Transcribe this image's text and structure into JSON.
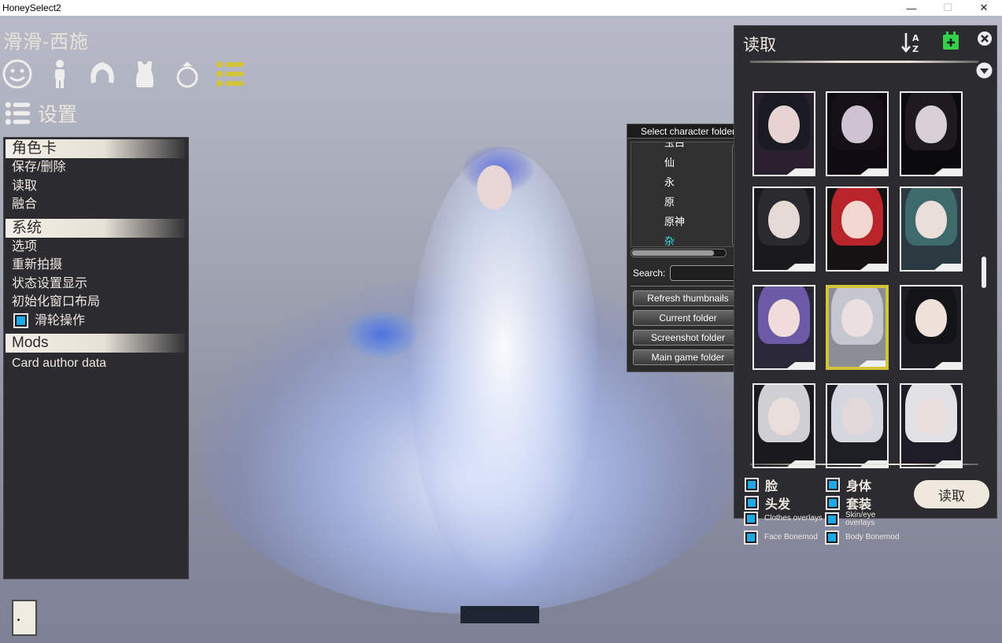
{
  "window": {
    "title": "HoneySelect2"
  },
  "header": {
    "character_name": "滑滑-西施",
    "settings_label": "设置"
  },
  "category_icons": [
    "face-icon",
    "body-icon",
    "hair-icon",
    "clothes-icon",
    "accessory-icon",
    "settings-list-icon"
  ],
  "left_menu": {
    "sections": [
      {
        "title": "角色卡",
        "items": [
          "保存/删除",
          "读取",
          "融合"
        ]
      },
      {
        "title": "系统",
        "items": [
          "选项",
          "重新拍摄",
          "状态设置显示",
          "初始化窗口布局"
        ],
        "toggle": {
          "label": "滑轮操作",
          "checked": true
        }
      },
      {
        "title": "Mods",
        "items": [
          "Card author data"
        ]
      }
    ]
  },
  "folder_popup": {
    "title": "Select character folder",
    "nodes": [
      {
        "label": "玉白",
        "selected": false
      },
      {
        "label": "仙",
        "selected": false
      },
      {
        "label": "永",
        "selected": false
      },
      {
        "label": "原",
        "selected": false
      },
      {
        "label": "原神",
        "selected": false
      },
      {
        "label": "杂",
        "selected": true
      }
    ],
    "search_label": "Search:",
    "search_value": "",
    "buttons": [
      "Refresh thumbnails",
      "Current folder",
      "Screenshot folder",
      "Main game folder"
    ]
  },
  "load_panel": {
    "title": "读取",
    "load_button": "读取",
    "options": [
      {
        "label": "脸",
        "checked": true,
        "small": false
      },
      {
        "label": "身体",
        "checked": true,
        "small": false
      },
      {
        "label": "头发",
        "checked": true,
        "small": false
      },
      {
        "label": "套装",
        "checked": true,
        "small": false
      },
      {
        "label": "Clothes overlays",
        "checked": true,
        "small": true
      },
      {
        "label": "Skin/eye overlays",
        "checked": true,
        "small": true
      },
      {
        "label": "Face Bonemod",
        "checked": true,
        "small": true
      },
      {
        "label": "Body Bonemod",
        "checked": true,
        "small": true
      }
    ],
    "thumbnails": [
      {
        "hair": "#1a1a22",
        "skin": "#e7d4d2",
        "bg": "#2a2030",
        "selected": false
      },
      {
        "hair": "#151018",
        "skin": "#cfc2d2",
        "bg": "#0e0c12",
        "selected": false
      },
      {
        "hair": "#1d1b1f",
        "skin": "#d8d0d4",
        "bg": "#0b0b0d",
        "selected": false
      },
      {
        "hair": "#2a2a2e",
        "skin": "#e6dad6",
        "bg": "#1a1a1c",
        "selected": false
      },
      {
        "hair": "#b8242a",
        "skin": "#f0d8d0",
        "bg": "#141212",
        "selected": false
      },
      {
        "hair": "#3e6a6c",
        "skin": "#eadfd8",
        "bg": "#2a3a40",
        "selected": false
      },
      {
        "hair": "#6c5aa6",
        "skin": "#f0dcd8",
        "bg": "#2a2838",
        "selected": false
      },
      {
        "hair": "#c4c6d0",
        "skin": "#ecdfe0",
        "bg": "#8a8c96",
        "selected": true
      },
      {
        "hair": "#121418",
        "skin": "#efe0da",
        "bg": "#1c1c22",
        "selected": false
      },
      {
        "hair": "#cfcfd4",
        "skin": "#e9dedc",
        "bg": "#1a1a1c",
        "selected": false
      },
      {
        "hair": "#d4d6e0",
        "skin": "#e2d8da",
        "bg": "#1c1e24",
        "selected": false
      },
      {
        "hair": "#e2e2e6",
        "skin": "#eadfdc",
        "bg": "#1e1c26",
        "selected": false
      }
    ]
  },
  "colors": {
    "accent_yellow": "#d4c43a",
    "check_blue": "#1fa8e6",
    "add_green": "#35d04a"
  }
}
